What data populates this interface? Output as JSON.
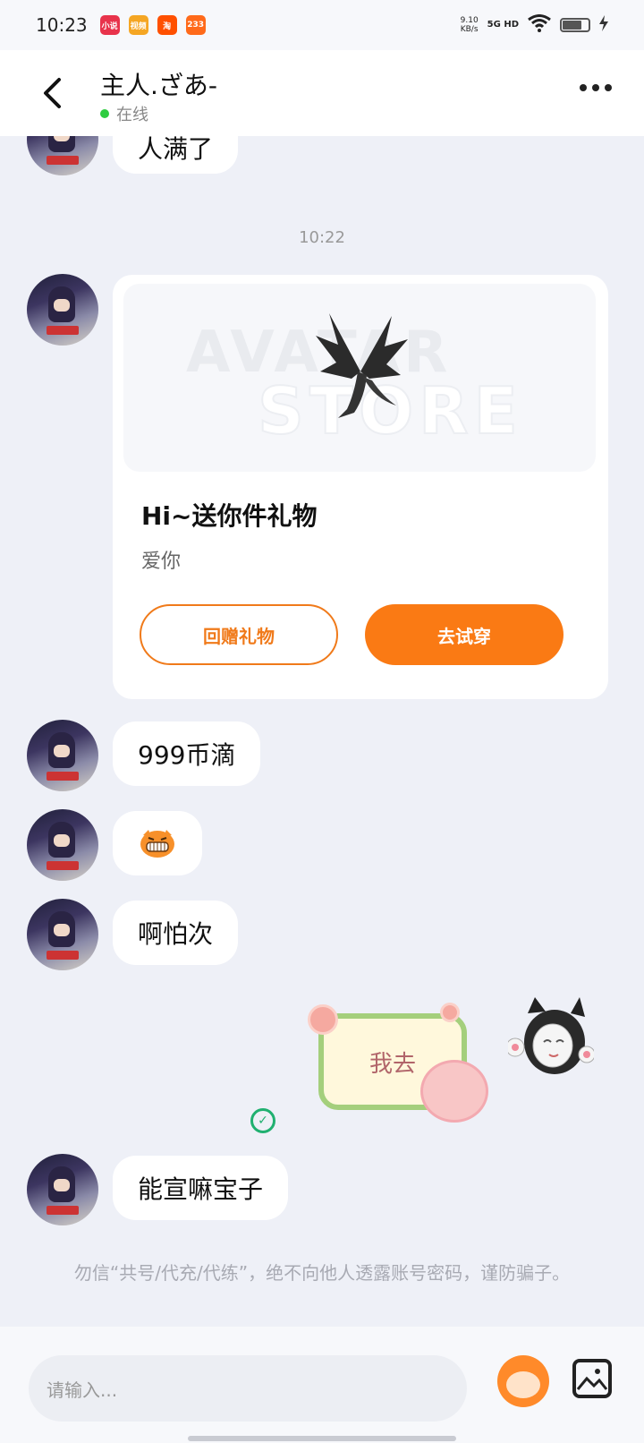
{
  "status_bar": {
    "time": "10:23",
    "apps": [
      "小说",
      "视频",
      "淘",
      "233"
    ],
    "speed": "9.10\nKB/s",
    "network": "5G HD"
  },
  "header": {
    "back_icon": "chevron-left-icon",
    "title": "主人.ざあ-",
    "presence": "在线",
    "more_icon": "more-dots-icon"
  },
  "messages": {
    "partial_text": "人满了",
    "timestamp": "10:22",
    "gift_card": {
      "watermark_top": "AVATAR",
      "watermark_bottom": "STORE",
      "title": "Hi~送你件礼物",
      "subtitle": "爱你",
      "return_gift_button": "回赠礼物",
      "try_on_button": "去试穿"
    },
    "text_1": "999币滴",
    "emoji_icon": "grinning-tiger-emoji",
    "text_2": "啊怕次",
    "sticker_text": "我去",
    "text_3": "能宣嘛宝子"
  },
  "notice": "勿信“共号/代充/代练”，绝不向他人透露账号密码，谨防骗子。",
  "input": {
    "placeholder": "请输入..."
  },
  "colors": {
    "accent": "#fa7a14",
    "online": "#2ecc40",
    "background": "#eef0f7"
  }
}
